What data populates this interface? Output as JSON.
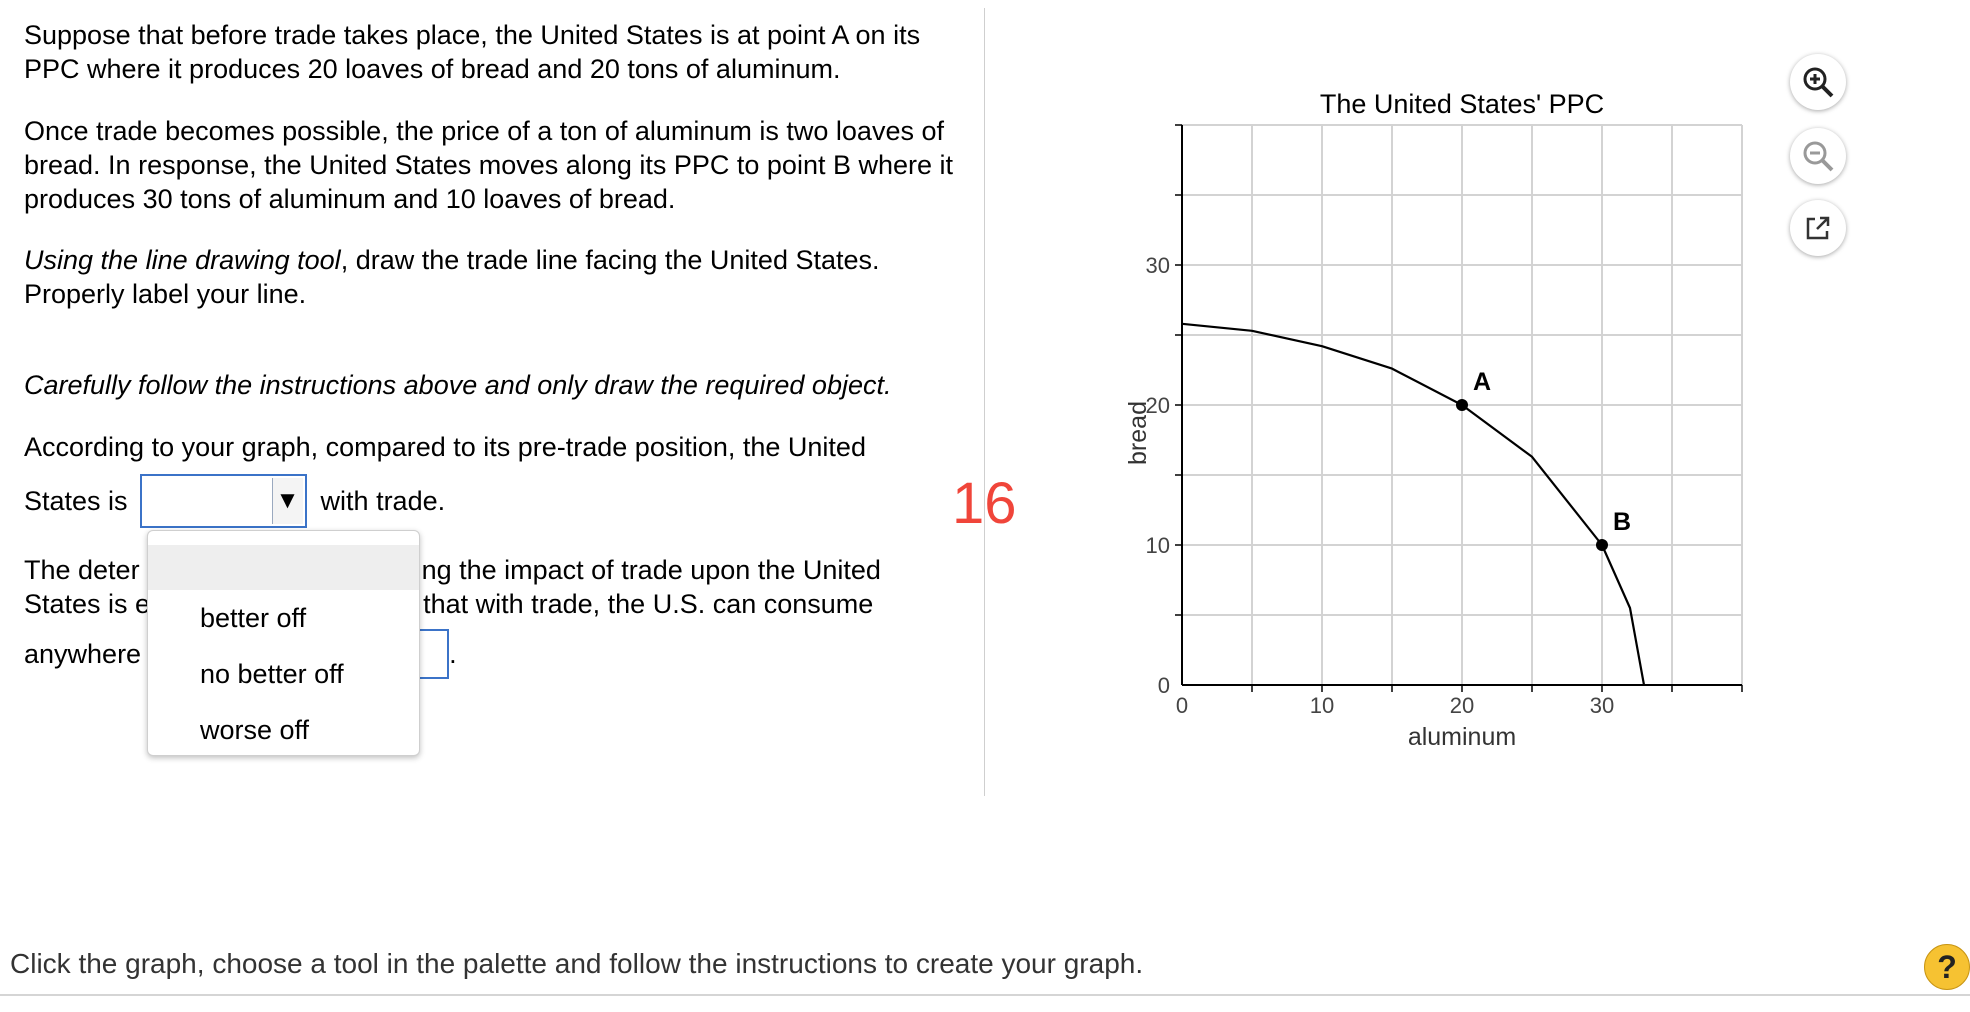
{
  "question": {
    "p1": "Suppose that before trade takes place, the United States is at point A on its PPC where it produces 20 loaves of bread and 20 tons of aluminum.",
    "p2": "Once trade becomes possible, the price of a ton of aluminum is two loaves of bread. In response, the United States moves along its PPC to point B where it produces 30 tons of aluminum and 10 loaves of bread.",
    "p3_italic": "Using the line drawing tool",
    "p3_rest": ", draw the trade line facing the United States. Properly label your line.",
    "p4": "Carefully follow the instructions above and only draw the required object.",
    "p5_a": "According to your graph, compared to its pre-trade position, the United",
    "p5_b": "States is",
    "p5_c": "with trade.",
    "p6_a_left": "The deter",
    "p6_a_right": "ling the impact of trade upon the United",
    "p6_b_left": "States is e",
    "p6_b_right": "that with trade, the U.S. can consume",
    "p6_c_left": "anywhere",
    "p6_c_right": "."
  },
  "dropdown": {
    "options": [
      "better off",
      "no better off",
      "worse off"
    ]
  },
  "badge": "16",
  "footer": "Click the graph, choose a tool in the palette and follow the instructions to create your graph.",
  "help": "?",
  "tools": [
    "zoom-in-icon",
    "zoom-out-icon",
    "popout-icon"
  ],
  "chart_data": {
    "type": "line",
    "title": "The United States' PPC",
    "xlabel": "aluminum",
    "ylabel": "bread",
    "xlim": [
      0,
      40
    ],
    "ylim": [
      0,
      40
    ],
    "xticks": [
      0,
      10,
      20,
      30
    ],
    "yticks": [
      0,
      10,
      20,
      30
    ],
    "grid": true,
    "series": [
      {
        "points": [
          [
            0,
            25.8
          ],
          [
            5,
            25.3
          ],
          [
            10,
            24.2
          ],
          [
            15,
            22.6
          ],
          [
            20,
            20
          ],
          [
            25,
            16.3
          ],
          [
            30,
            10
          ],
          [
            32,
            5.5
          ],
          [
            33,
            0
          ]
        ]
      }
    ],
    "points": [
      {
        "label": "A",
        "x": 20,
        "y": 20
      },
      {
        "label": "B",
        "x": 30,
        "y": 10
      }
    ]
  }
}
